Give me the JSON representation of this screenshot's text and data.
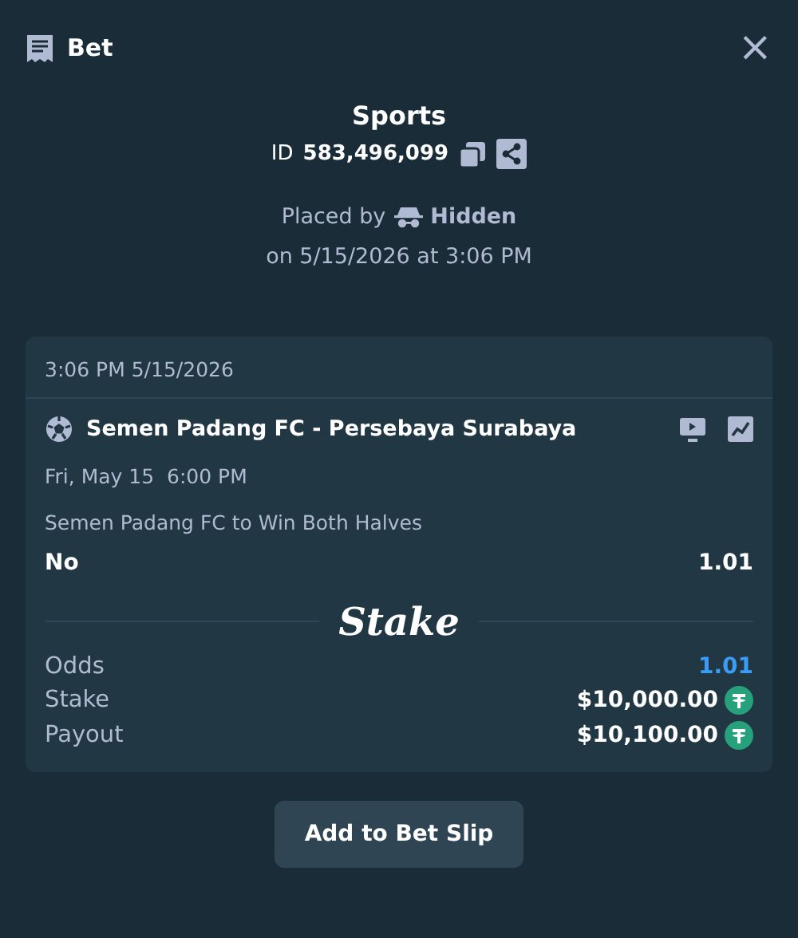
{
  "header": {
    "title": "Bet",
    "close": "×"
  },
  "summary": {
    "category": "Sports",
    "id_label": "ID",
    "id_value": "583,496,099",
    "placed_by_label": "Placed by",
    "placed_by_user": "Hidden",
    "placed_on": "on 5/15/2026 at 3:06 PM"
  },
  "bet": {
    "timestamp": "3:06 PM 5/15/2026",
    "event": "Semen Padang FC - Persebaya Surabaya",
    "event_time": "Fri, May 15  6:00 PM",
    "market": "Semen Padang FC to Win Both Halves",
    "outcome": "No",
    "outcome_odds": "1.01",
    "brand": "Stake",
    "details": [
      {
        "label": "Odds",
        "value": "1.01",
        "kind": "odds"
      },
      {
        "label": "Stake",
        "value": "$10,000.00",
        "kind": "amount"
      },
      {
        "label": "Payout",
        "value": "$10,100.00",
        "kind": "amount"
      }
    ]
  },
  "buttons": [
    "Add to Bet Slip"
  ]
}
